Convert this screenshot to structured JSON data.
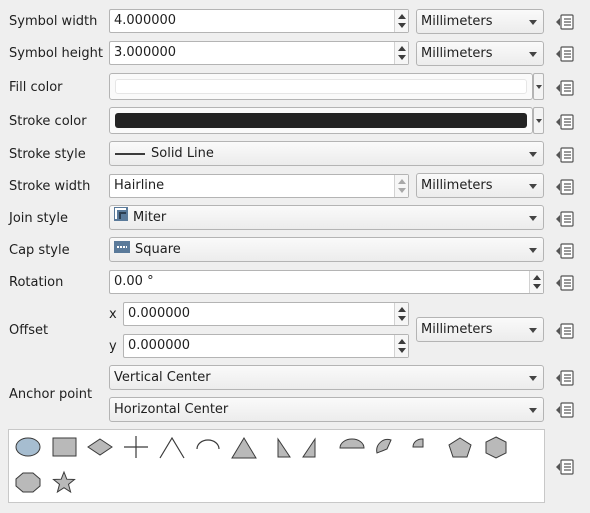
{
  "rows": {
    "symbol_width": {
      "label": "Symbol width",
      "value": "4.000000",
      "unit": "Millimeters"
    },
    "symbol_height": {
      "label": "Symbol height",
      "value": "3.000000",
      "unit": "Millimeters"
    },
    "fill_color": {
      "label": "Fill color",
      "color": "#ffffff"
    },
    "stroke_color": {
      "label": "Stroke color",
      "color": "#232323"
    },
    "stroke_style": {
      "label": "Stroke style",
      "value": "Solid Line"
    },
    "stroke_width": {
      "label": "Stroke width",
      "value": "Hairline",
      "unit": "Millimeters"
    },
    "join_style": {
      "label": "Join style",
      "value": "Miter"
    },
    "cap_style": {
      "label": "Cap style",
      "value": "Square"
    },
    "rotation": {
      "label": "Rotation",
      "value": "0.00 °"
    },
    "offset": {
      "label": "Offset",
      "x_label": "x",
      "x_value": "0.000000",
      "y_label": "y",
      "y_value": "0.000000",
      "unit": "Millimeters"
    },
    "anchor_point": {
      "label": "Anchor point",
      "vertical": "Vertical Center",
      "horizontal": "Horizontal Center"
    }
  },
  "shapes": [
    "ellipse",
    "rectangle",
    "diamond",
    "cross",
    "triangle-outline",
    "arc",
    "triangle",
    "left-half-triangle",
    "right-half-triangle",
    "semi-circle",
    "third-circle",
    "quarter-circle",
    "pentagon",
    "hexagon",
    "octagon",
    "star"
  ],
  "icons": {
    "data_defined": "data-defined-override-icon"
  }
}
